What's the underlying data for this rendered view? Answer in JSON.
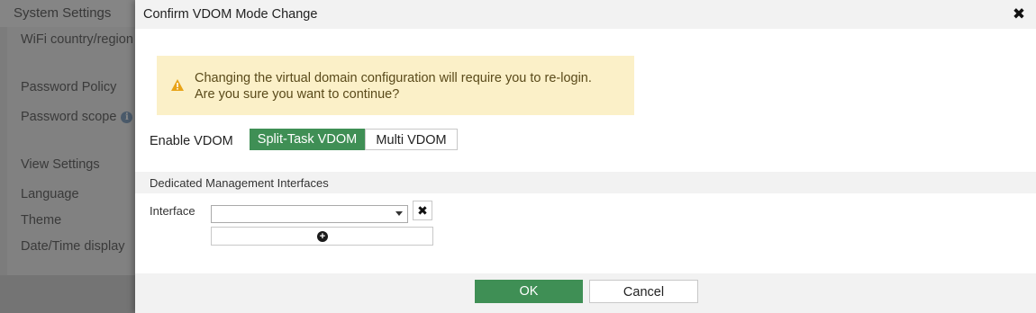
{
  "background": {
    "header": "System Settings",
    "items": [
      "WiFi country/region",
      "Password Policy",
      "Password scope",
      "View Settings",
      "Language",
      "Theme",
      "Date/Time display"
    ]
  },
  "dialog": {
    "title": "Confirm VDOM Mode Change",
    "warning_line1": "Changing the virtual domain configuration will require you to re-login.",
    "warning_line2": "Are you sure you want to continue?",
    "enable_vdom_label": "Enable VDOM",
    "vdom_options": [
      "Split-Task VDOM",
      "Multi VDOM"
    ],
    "vdom_selected": "Split-Task VDOM",
    "section_title": "Dedicated Management Interfaces",
    "interface_label": "Interface",
    "interface_value": "",
    "ok_label": "OK",
    "cancel_label": "Cancel"
  },
  "colors": {
    "accent": "#3f8f55",
    "warning_bg": "#fbf0c8",
    "warning_icon": "#e8a317"
  },
  "icons": {
    "close": "close-icon",
    "warning": "warning-icon",
    "info": "info-icon",
    "remove": "remove-icon",
    "add": "add-icon",
    "dropdown": "chevron-down-icon"
  }
}
